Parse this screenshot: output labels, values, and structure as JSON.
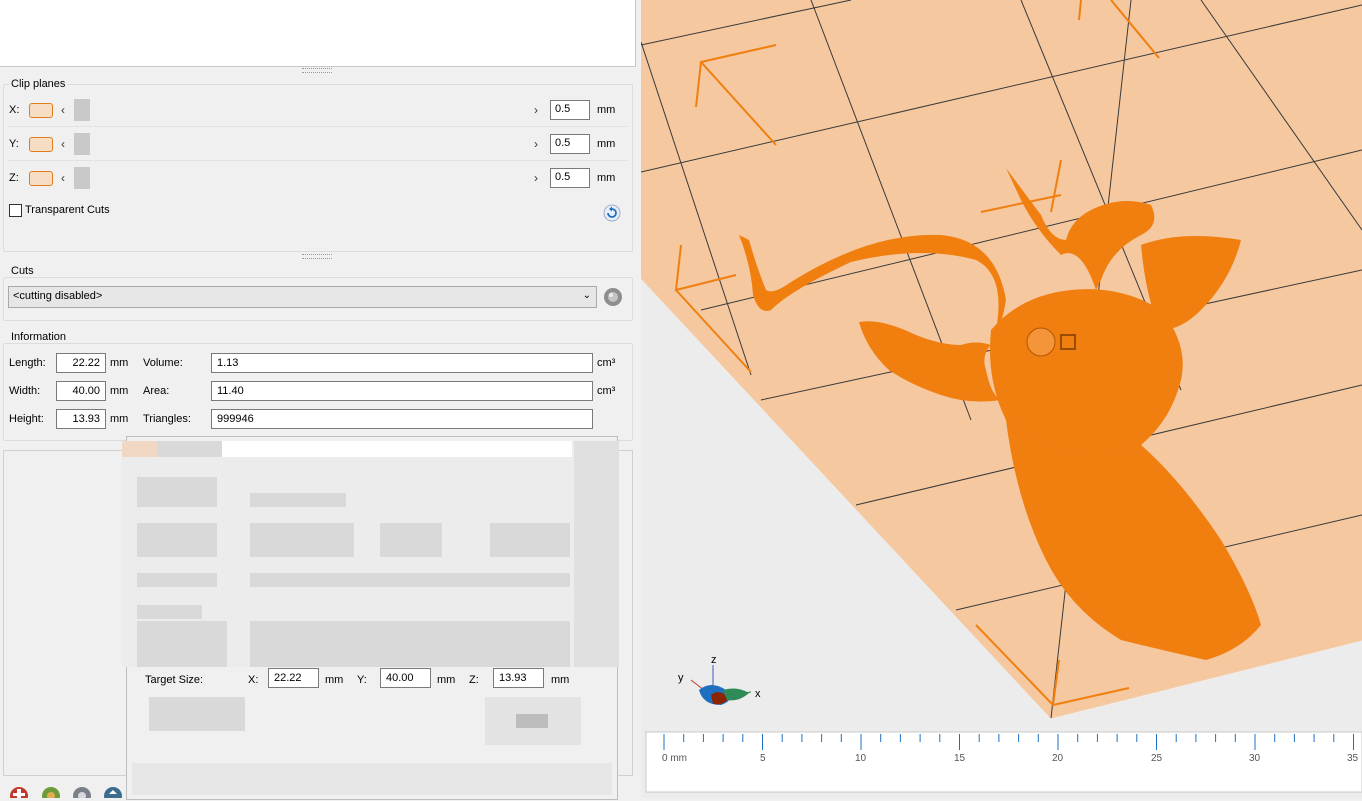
{
  "clip_planes": {
    "title": "Clip planes",
    "rows": [
      {
        "axis": "X:",
        "value": "0.5",
        "unit": "mm"
      },
      {
        "axis": "Y:",
        "value": "0.5",
        "unit": "mm"
      },
      {
        "axis": "Z:",
        "value": "0.5",
        "unit": "mm"
      }
    ],
    "transparent_cuts_label": "Transparent Cuts",
    "transparent_cuts_checked": false
  },
  "cuts": {
    "title": "Cuts",
    "selected": "<cutting disabled>"
  },
  "information": {
    "title": "Information",
    "length_label": "Length:",
    "length": "22.22",
    "length_unit": "mm",
    "width_label": "Width:",
    "width": "40.00",
    "width_unit": "mm",
    "height_label": "Height:",
    "height": "13.93",
    "height_unit": "mm",
    "volume_label": "Volume:",
    "volume": "1.13",
    "volume_unit": "cm³",
    "area_label": "Area:",
    "area": "11.40",
    "area_unit": "cm³",
    "triangles_label": "Triangles:",
    "triangles": "999946"
  },
  "scale_dialog": {
    "target_size_label": "Target Size:",
    "x_label": "X:",
    "x": "22.22",
    "x_unit": "mm",
    "y_label": "Y:",
    "y": "40.00",
    "y_unit": "mm",
    "z_label": "Z:",
    "z": "13.93",
    "z_unit": "mm"
  },
  "viewport": {
    "axis_labels": {
      "x": "x",
      "y": "y",
      "z": "z"
    },
    "ruler_labels": [
      "0 mm",
      "5",
      "10",
      "15",
      "20",
      "25",
      "30",
      "35"
    ],
    "plate_color": "#f5c8a0",
    "model_color": "#f07f10"
  },
  "colors": {
    "accent": "#e07c1e",
    "panel_bg": "#f0f0f0"
  }
}
